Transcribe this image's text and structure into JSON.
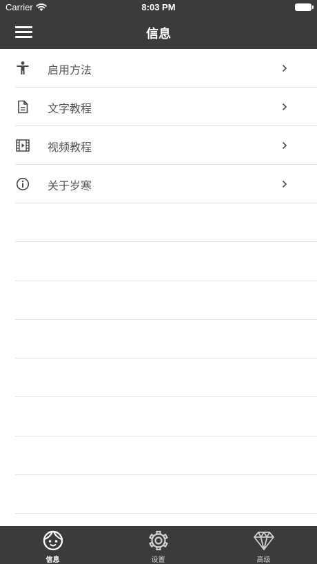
{
  "status_bar": {
    "carrier": "Carrier",
    "time": "8:03 PM",
    "wifi_icon": "wifi-icon",
    "battery_icon": "battery-icon"
  },
  "nav_bar": {
    "title": "信息",
    "menu_icon": "hamburger-menu-icon"
  },
  "menu_items": [
    {
      "label": "启用方法",
      "icon": "accessibility-icon"
    },
    {
      "label": "文字教程",
      "icon": "document-icon"
    },
    {
      "label": "视频教程",
      "icon": "video-film-icon"
    },
    {
      "label": "关于岁寒",
      "icon": "info-icon"
    }
  ],
  "tab_bar": {
    "tabs": [
      {
        "label": "信息",
        "icon": "face-icon",
        "active": true
      },
      {
        "label": "设置",
        "icon": "gear-icon",
        "active": false
      },
      {
        "label": "高级",
        "icon": "diamond-icon",
        "active": false
      }
    ]
  },
  "colors": {
    "bar_background": "#3b3b3b",
    "text_gray": "#555555",
    "divider": "#e2e2e2",
    "white": "#ffffff"
  }
}
